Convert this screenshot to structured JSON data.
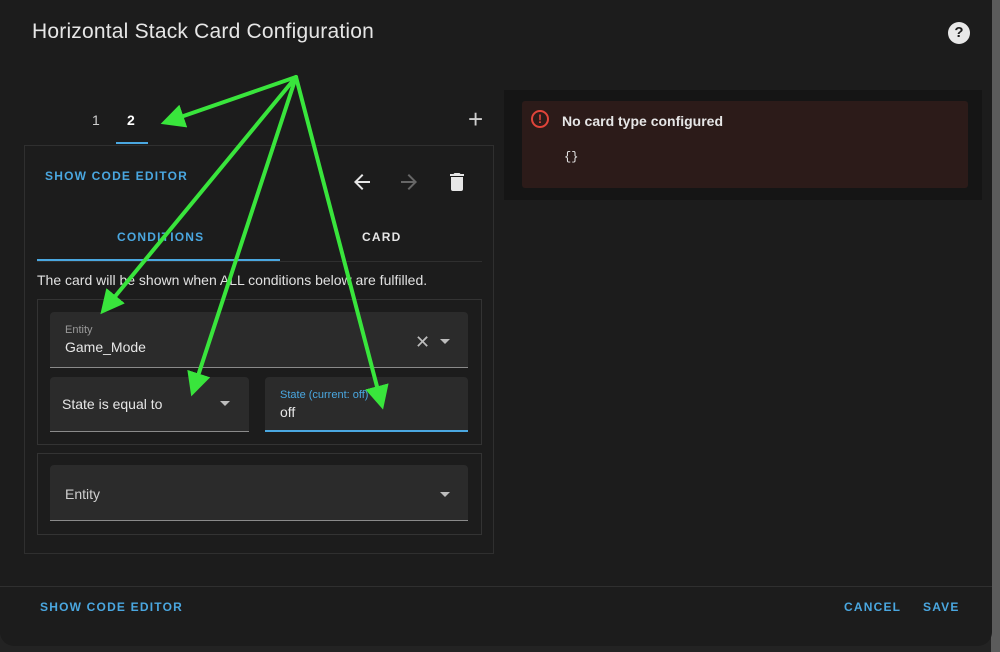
{
  "dialog": {
    "title": "Horizontal Stack Card Configuration",
    "help_icon": "help-circle-icon"
  },
  "stack_tabs": {
    "items": [
      "1",
      "2"
    ],
    "active": "2",
    "add_icon": "plus-icon"
  },
  "editor": {
    "show_code_label": "SHOW CODE EDITOR",
    "toolbar_icons": [
      "arrow-left-icon",
      "arrow-right-icon",
      "delete-icon"
    ],
    "tabs": {
      "conditions": "CONDITIONS",
      "card": "CARD",
      "active": "CONDITIONS"
    },
    "info_text": "The card will be shown when ALL conditions below are fulfilled.",
    "condition1": {
      "entity_label": "Entity",
      "entity_value": "Game_Mode",
      "operator_value": "State is equal to",
      "state_label": "State (current: off)",
      "state_value": "off"
    },
    "condition2": {
      "entity_placeholder": "Entity"
    }
  },
  "preview": {
    "error_icon": "alert-circle-icon",
    "error_title": "No card type configured",
    "error_code": "{}"
  },
  "footer": {
    "show_code_label": "SHOW CODE EDITOR",
    "cancel_label": "CANCEL",
    "save_label": "SAVE"
  },
  "colors": {
    "background": "#1c1c1c",
    "accent": "#4aa7e0",
    "error": "#e0443a",
    "annotation_arrow": "#39e53c"
  }
}
